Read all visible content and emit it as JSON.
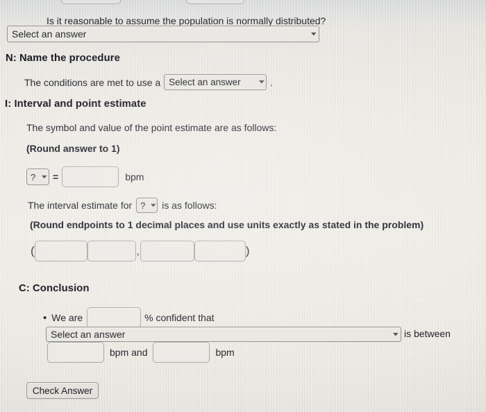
{
  "page": {
    "background_color": "#ebe9e3",
    "top_band_color": "#d9dadc"
  },
  "top_partial_fields": [
    {
      "name": "partial-answer-box-1",
      "value": ""
    },
    {
      "name": "partial-answer-box-2",
      "value": ""
    }
  ],
  "normality": {
    "question": "Is it reasonable to assume the population is normally distributed?",
    "select_value": "Select an answer",
    "caret_icon": "chevron-down-icon"
  },
  "name_procedure": {
    "heading": "N: Name the procedure",
    "sentence_before": "The conditions are met to use a",
    "select_value": "Select an answer",
    "sentence_after": ".",
    "caret_icon": "chevron-down-icon"
  },
  "interval_point_estimate": {
    "heading": "I: Interval and point estimate",
    "point_estimate_intro": "The symbol and value of the point estimate are as follows:",
    "round_note_1": "(Round answer to 1)",
    "symbol_select_value": "?",
    "equals_sign": "=",
    "point_estimate_value": "",
    "unit": "bpm",
    "interval_intro_before": "The interval estimate for",
    "interval_symbol_select_value": "?",
    "interval_intro_after": "is as follows:",
    "round_note_2": "(Round endpoints to 1 decimal places and use units exactly as stated in the problem)",
    "open_paren": "(",
    "close_paren": ")",
    "comma": ",",
    "interval_fields": [
      "",
      "",
      "",
      ""
    ]
  },
  "conclusion": {
    "heading": "C: Conclusion",
    "bullet": "•",
    "we_are_text": "We are",
    "confidence_value": "",
    "percent_confident_text": "% confident that",
    "parameter_select_value": "Select an answer",
    "is_between_text": "is between",
    "lower_value": "",
    "bpm_and_text": "bpm and",
    "upper_value": "",
    "bpm_text": "bpm",
    "caret_icon": "chevron-down-icon"
  },
  "footer": {
    "check_answer_label": "Check Answer"
  }
}
